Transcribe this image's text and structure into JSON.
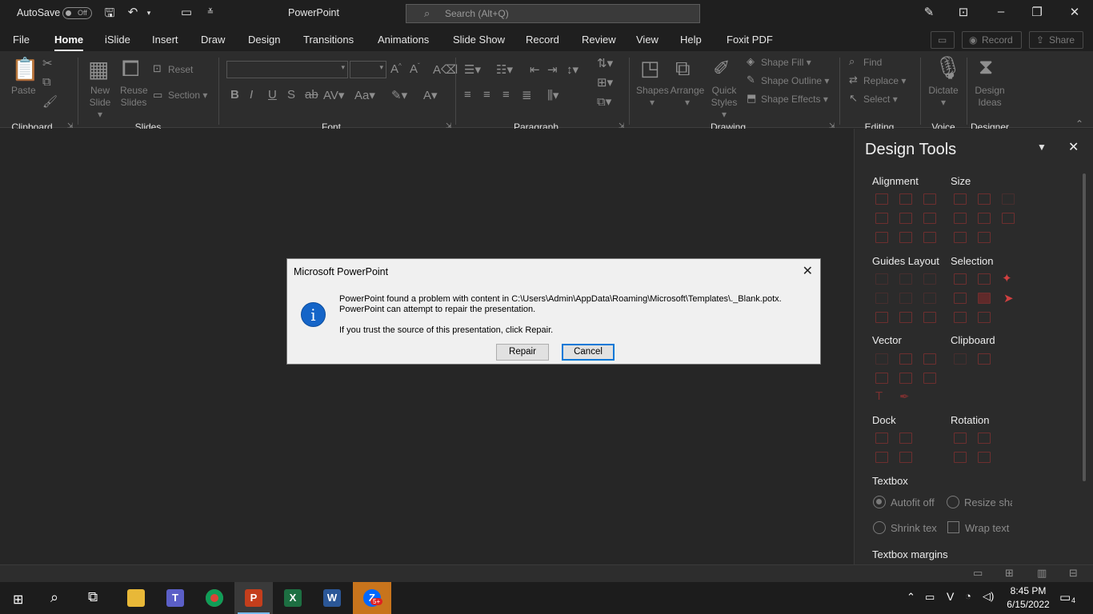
{
  "titlebar": {
    "autosave_label": "AutoSave",
    "autosave_state": "Off",
    "app_title": "PowerPoint",
    "search_placeholder": "Search (Alt+Q)"
  },
  "tabs": [
    "File",
    "Home",
    "iSlide",
    "Insert",
    "Draw",
    "Design",
    "Transitions",
    "Animations",
    "Slide Show",
    "Record",
    "Review",
    "View",
    "Help",
    "Foxit PDF"
  ],
  "active_tab": "Home",
  "top_buttons": {
    "record": "Record",
    "share": "Share"
  },
  "ribbon": {
    "clipboard": {
      "paste": "Paste",
      "group": "Clipboard"
    },
    "slides": {
      "new_slide_1": "New",
      "new_slide_2": "Slide",
      "reuse_1": "Reuse",
      "reuse_2": "Slides",
      "reset": "Reset",
      "section": "Section",
      "group": "Slides"
    },
    "font": {
      "group": "Font"
    },
    "paragraph": {
      "group": "Paragraph"
    },
    "drawing": {
      "shapes": "Shapes",
      "arrange": "Arrange",
      "quick_1": "Quick",
      "quick_2": "Styles",
      "shape_fill": "Shape Fill",
      "shape_outline": "Shape Outline",
      "shape_effects": "Shape Effects",
      "group": "Drawing"
    },
    "editing": {
      "find": "Find",
      "replace": "Replace",
      "select": "Select",
      "group": "Editing"
    },
    "voice": {
      "dictate": "Dictate",
      "group": "Voice"
    },
    "designer": {
      "ideas_1": "Design",
      "ideas_2": "Ideas",
      "group": "Designer"
    }
  },
  "pane": {
    "title": "Design Tools",
    "sections": {
      "alignment": "Alignment",
      "size": "Size",
      "guides_layout": "Guides Layout",
      "selection": "Selection",
      "vector": "Vector",
      "clipboard": "Clipboard",
      "dock": "Dock",
      "rotation": "Rotation",
      "textbox": "Textbox",
      "textbox_margins": "Textbox margins"
    },
    "options": {
      "autofit": "Autofit off",
      "resize": "Resize shape",
      "shrink": "Shrink text",
      "wrap": "Wrap text"
    }
  },
  "dialog": {
    "title": "Microsoft PowerPoint",
    "line1": "PowerPoint found a problem with content in C:\\Users\\Admin\\AppData\\Roaming\\Microsoft\\Templates\\._Blank.potx.",
    "line2": "PowerPoint can attempt to repair the presentation.",
    "line3": "If you trust the source of this presentation, click Repair.",
    "repair": "Repair",
    "cancel": "Cancel"
  },
  "taskbar": {
    "time": "8:45 PM",
    "date": "6/15/2022",
    "notifications": "4",
    "badge": "5+"
  }
}
